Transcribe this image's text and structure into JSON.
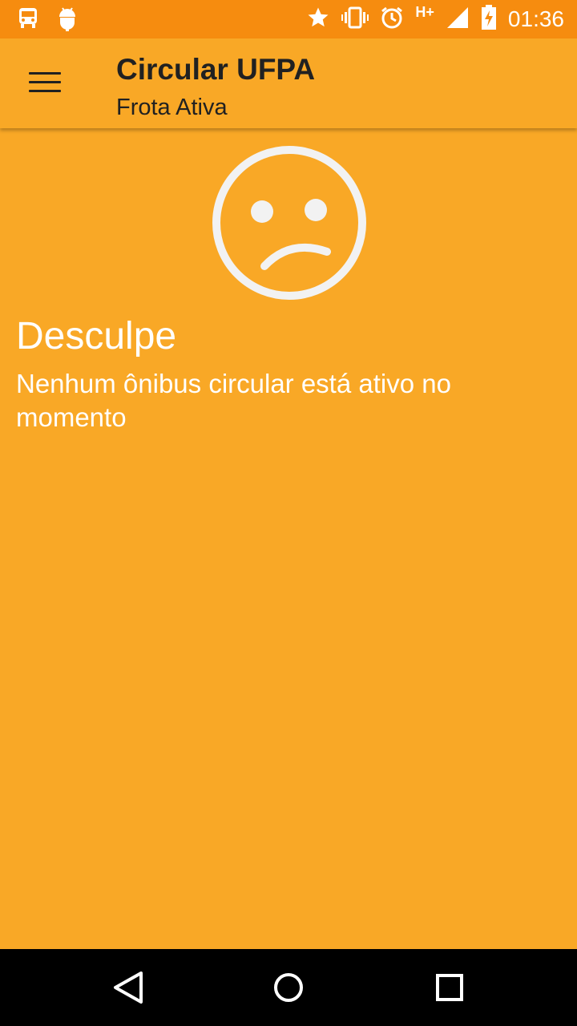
{
  "status_bar": {
    "time": "01:36",
    "network_type": "H+",
    "left_icons": [
      "bus-icon",
      "android-icon"
    ],
    "right_icons": [
      "star-icon",
      "vibrate-icon",
      "alarm-icon",
      "signal-icon",
      "battery-charging-icon"
    ]
  },
  "app_bar": {
    "title": "Circular UFPA",
    "subtitle": "Frota Ativa",
    "menu_icon": "menu-icon"
  },
  "empty_state": {
    "icon": "sad-face-icon",
    "title": "Desculpe",
    "message": "Nenhum ônibus circular está ativo no momento"
  },
  "nav_bar": {
    "buttons": [
      "back-icon",
      "home-icon",
      "recents-icon"
    ]
  },
  "colors": {
    "status_bar": "#F68C0F",
    "background": "#F9A826",
    "text_primary": "#212121",
    "text_on_background": "#FFFFFF"
  }
}
